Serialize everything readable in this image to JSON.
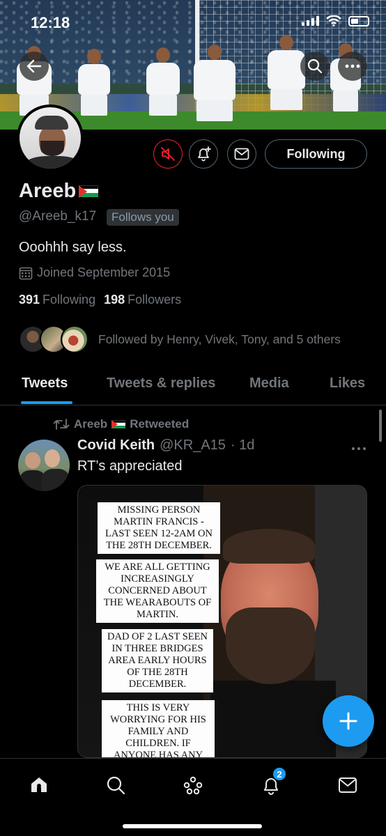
{
  "status_bar": {
    "time": "12:18"
  },
  "profile": {
    "name": "Areeb",
    "handle": "@Areeb_k17",
    "follows_you": "Follows you",
    "bio": "Ooohhh say less.",
    "joined": "Joined September 2015",
    "following_count": "391",
    "following_label": "Following",
    "followers_count": "198",
    "followers_label": "Followers",
    "followed_by": "Followed by Henry, Vivek, Tony, and 5 others",
    "following_button": "Following"
  },
  "tabs": [
    {
      "label": "Tweets",
      "active": true
    },
    {
      "label": "Tweets & replies",
      "active": false
    },
    {
      "label": "Media",
      "active": false
    },
    {
      "label": "Likes",
      "active": false
    }
  ],
  "tweet": {
    "retweeted_by": "Areeb",
    "retweeted_label": "Retweeted",
    "author_name": "Covid Keith",
    "author_handle": "@KR_A15",
    "time": "· 1d",
    "text": "RT’s appreciated",
    "image_notices": [
      "Missing person Martin Francis - last seen 12-2am on the 28th December.",
      "We are all getting increasingly concerned about the wearabouts of Martin.",
      "Dad of 2 last seen in Three Bridges area early hours of the 28th December.",
      "This is very worrying for his family and children. If anyone has any"
    ]
  },
  "bottom_nav": {
    "notifications_badge": "2",
    "items": [
      "home-icon",
      "search-icon",
      "spaces-icon",
      "notifications-icon",
      "messages-icon"
    ]
  },
  "colors": {
    "accent": "#1d9bf0",
    "muted": "#71767b",
    "mute_red": "#f4212e",
    "background": "#000000"
  }
}
